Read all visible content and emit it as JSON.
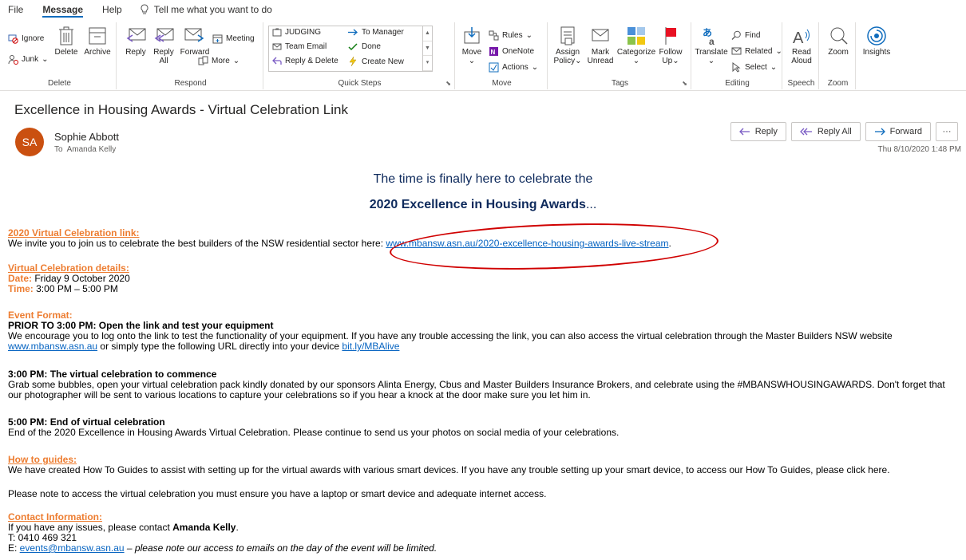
{
  "tabs": [
    "File",
    "Message",
    "Help"
  ],
  "active_tab": "Message",
  "tell_me": "Tell me what you want to do",
  "ribbon": {
    "delete_group": {
      "label": "Delete",
      "ignore": "Ignore",
      "junk": "Junk",
      "delete": "Delete",
      "archive": "Archive"
    },
    "respond_group": {
      "label": "Respond",
      "reply": "Reply",
      "reply_all_1": "Reply",
      "reply_all_2": "All",
      "forward": "Forward",
      "meeting": "Meeting",
      "more": "More"
    },
    "quick_steps": {
      "label": "Quick Steps",
      "items": [
        "JUDGING",
        "Team Email",
        "Reply & Delete",
        "To Manager",
        "Done",
        "Create New"
      ]
    },
    "move_group": {
      "label": "Move",
      "move": "Move",
      "rules": "Rules",
      "onenote": "OneNote",
      "actions": "Actions"
    },
    "tags_group": {
      "label": "Tags",
      "assign_1": "Assign",
      "assign_2": "Policy",
      "mark_1": "Mark",
      "mark_2": "Unread",
      "categorize": "Categorize",
      "follow_1": "Follow",
      "follow_2": "Up"
    },
    "editing_group": {
      "label": "Editing",
      "translate": "Translate",
      "find": "Find",
      "related": "Related",
      "select": "Select"
    },
    "speech_group": {
      "label": "Speech",
      "read_1": "Read",
      "read_2": "Aloud"
    },
    "zoom_group": {
      "label": "Zoom",
      "zoom": "Zoom"
    },
    "insights": "Insights"
  },
  "message": {
    "subject": "Excellence in Housing Awards - Virtual Celebration Link",
    "avatar_initials": "SA",
    "sender": "Sophie Abbott",
    "to_label": "To",
    "to": "Amanda Kelly",
    "date": "Thu 8/10/2020 1:48 PM",
    "reply": "Reply",
    "reply_all": "Reply All",
    "forward": "Forward",
    "more": "···"
  },
  "body": {
    "headline1": "The time is finally here to celebrate the",
    "headline2": "2020 Excellence in Housing Awards",
    "headline2_suffix": "...",
    "link_heading": "2020 Virtual Celebration link:",
    "link_text": "We invite you to join us to celebrate the best builders of the NSW residential sector here: ",
    "link_url": "www.mbansw.asn.au/2020-excellence-housing-awards-live-stream",
    "link_end": ".",
    "details_heading": "Virtual Celebration details:",
    "date_label": "Date:",
    "date_value": " Friday 9 October 2020",
    "time_label": "Time:",
    "time_value": " 3:00 PM – 5:00 PM",
    "format_heading": "Event Format:",
    "prior_heading": "PRIOR TO 3:00 PM: Open the link and test your equipment",
    "prior_text": "We encourage you to log onto the link to test the functionality of your equipment. If you have any trouble accessing the link, you can also access the virtual celebration through the Master Builders NSW website ",
    "prior_link1": "www.mbansw.asn.au",
    "prior_mid": " or simply type the following URL directly into your device ",
    "prior_link2": "bit.ly/MBAlive",
    "three_label": "3:00 PM",
    "three_heading": ": The virtual celebration to commence",
    "three_text": "Grab some bubbles, open your virtual celebration pack kindly donated by our sponsors Alinta Energy, Cbus and Master Builders Insurance Brokers, and celebrate using the #MBANSWHOUSINGAWARDS. Don't forget that our photographer will be sent to various locations to capture your celebrations so if you hear a knock at the door make sure you let him in.",
    "five_label": "5:00 PM",
    "five_heading": ": End of virtual celebration",
    "five_text": "End of the 2020 Excellence in Housing Awards Virtual Celebration. Please continue to send us your photos on social media of your celebrations.",
    "howto_heading": "How to guides:",
    "howto_text": "We have created How To Guides to assist with setting up for the virtual awards with various smart devices. If you have any trouble setting up your smart device, to access our How To Guides, please click here.",
    "note_text": "Please note to access the virtual celebration you must ensure you have a laptop or smart device and adequate internet access.",
    "contact_heading": "Contact Information:",
    "contact_text": "If you have any issues, please contact ",
    "contact_name": "Amanda Kelly",
    "contact_end": ".",
    "phone": "T: 0410 469 321",
    "email_label": "E: ",
    "email": "events@mbansw.asn.au",
    "email_note": " – please note our access to emails on the day of the event will be limited."
  },
  "colors": {
    "accent": "#0f6cbd",
    "avatar": "#ca5010",
    "heading_orange": "#ed7d31",
    "link": "#0563c1",
    "annotation": "#d00000"
  }
}
